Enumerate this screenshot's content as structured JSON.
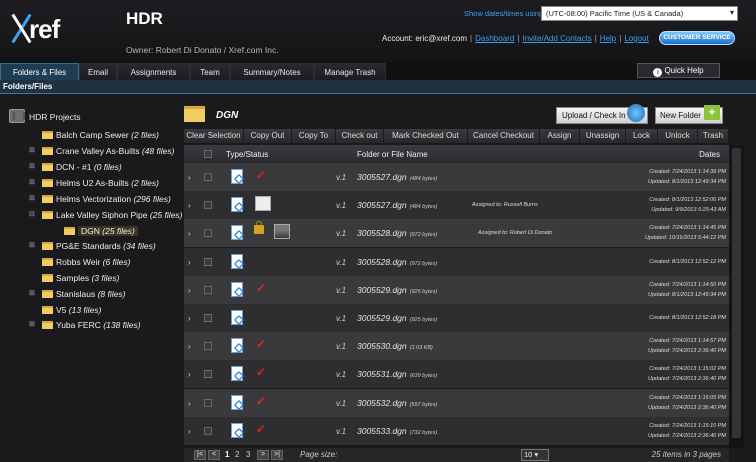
{
  "header": {
    "logo": "ref",
    "project_title": "HDR",
    "owner": "Owner: Robert Di Donato / Xref.com Inc.",
    "tz_label": "Show dates/times using:",
    "tz_value": "(UTC-08:00) Pacific Time (US & Canada)",
    "account": "Account: eric@xref.com",
    "links": [
      "Dashboard",
      "Invite/Add Contacts",
      "Help",
      "Logout"
    ],
    "customer_service": "CUSTOMER SERVICE"
  },
  "tabs": [
    "Folders & Files",
    "Email",
    "Assignments",
    "Team",
    "Summary/Notes",
    "Manage Trash"
  ],
  "quick_help": "Quick Help",
  "section_label": "Folders/Files",
  "tree": {
    "root": "HDR Projects",
    "items": [
      {
        "name": "Balch Camp Sewer",
        "count": "(2 files)"
      },
      {
        "name": "Crane Valley As-Builts",
        "count": "(48 files)"
      },
      {
        "name": "DCN - #1",
        "count": "(0 files)"
      },
      {
        "name": "Helms U2 As-Builts",
        "count": "(2 files)"
      },
      {
        "name": "Helms Vectorization",
        "count": "(296 files)"
      },
      {
        "name": "Lake Valley Siphon Pipe",
        "count": "(25 files)"
      },
      {
        "name": "DGN",
        "count": "(25 files)"
      },
      {
        "name": "PG&E Standards",
        "count": "(34 files)"
      },
      {
        "name": "Robbs Weir",
        "count": "(6 files)"
      },
      {
        "name": "Samples",
        "count": "(3 files)"
      },
      {
        "name": "Stanislaus",
        "count": "(8 files)"
      },
      {
        "name": "V5",
        "count": "(13 files)"
      },
      {
        "name": "Yuba FERC",
        "count": "(138 files)"
      }
    ]
  },
  "current_folder": "DGN",
  "buttons": {
    "upload": "Upload / Check In",
    "new_folder": "New Folder"
  },
  "actions": [
    "Clear Selection",
    "Copy Out",
    "Copy To",
    "Check out",
    "Mark Checked Out",
    "Cancel Checkout",
    "Assign",
    "Unassign",
    "Lock",
    "Unlock",
    "Trash"
  ],
  "columns": {
    "type": "Type/Status",
    "name": "Folder or File Name",
    "dates": "Dates"
  },
  "files": [
    {
      "ver": "v.1",
      "name": "3005527.dgn",
      "size": "(484 bytes)",
      "assigned": "",
      "created": "Created: 7/24/2013 1:14:39 PM",
      "updated": "Updated: 8/1/2013 12:49:34 PM",
      "check": true,
      "lock": false,
      "avatar": "none"
    },
    {
      "ver": "v.1",
      "name": "3005527.dgn",
      "size": "(484 bytes)",
      "assigned": "Assigned to: Russell Burns",
      "created": "Created: 8/1/2013 12:52:06 PM",
      "updated": "Updated: 9/9/2013 6:25:43 AM",
      "check": false,
      "lock": false,
      "avatar": "blank"
    },
    {
      "ver": "v.1",
      "name": "3005528.dgn",
      "size": "(972 bytes)",
      "assigned": "Assigned to: Robert Di Donato",
      "created": "Created: 7/24/2013 1:14:45 PM",
      "updated": "Updated: 10/16/2013 5:44:12 PM",
      "check": false,
      "lock": true,
      "avatar": "photo"
    },
    {
      "ver": "v.1",
      "name": "3005528.dgn",
      "size": "(972 bytes)",
      "assigned": "",
      "created": "Created: 8/1/2013 12:52:12 PM",
      "updated": "",
      "check": false,
      "lock": false,
      "avatar": "none"
    },
    {
      "ver": "v.1",
      "name": "3005529.dgn",
      "size": "(925 bytes)",
      "assigned": "",
      "created": "Created: 7/24/2013 1:14:50 PM",
      "updated": "Updated: 8/1/2013 12:49:34 PM",
      "check": true,
      "lock": false,
      "avatar": "none"
    },
    {
      "ver": "v.1",
      "name": "3005529.dgn",
      "size": "(925 bytes)",
      "assigned": "",
      "created": "Created: 8/1/2013 12:52:18 PM",
      "updated": "",
      "check": false,
      "lock": false,
      "avatar": "none"
    },
    {
      "ver": "v.1",
      "name": "3005530.dgn",
      "size": "(1.03 KB)",
      "assigned": "",
      "created": "Created: 7/24/2013 1:14:57 PM",
      "updated": "Updated: 7/24/2013 2:36:40 PM",
      "check": true,
      "lock": false,
      "avatar": "none"
    },
    {
      "ver": "v.1",
      "name": "3005531.dgn",
      "size": "(639 bytes)",
      "assigned": "",
      "created": "Created: 7/24/2013 1:15:02 PM",
      "updated": "Updated: 7/24/2013 2:36:40 PM",
      "check": true,
      "lock": false,
      "avatar": "none"
    },
    {
      "ver": "v.1",
      "name": "3005532.dgn",
      "size": "(597 bytes)",
      "assigned": "",
      "created": "Created: 7/24/2013 1:15:05 PM",
      "updated": "Updated: 7/24/2013 2:36:40 PM",
      "check": true,
      "lock": false,
      "avatar": "none"
    },
    {
      "ver": "v.1",
      "name": "3005533.dgn",
      "size": "(732 bytes)",
      "assigned": "",
      "created": "Created: 7/24/2013 1:15:10 PM",
      "updated": "Updated: 7/24/2013 2:36:40 PM",
      "check": true,
      "lock": false,
      "avatar": "none"
    }
  ],
  "pager": {
    "pages": [
      "1",
      "2",
      "3"
    ],
    "page_size_label": "Page size:",
    "page_size": "10",
    "summary": "25 items in 3 pages"
  },
  "icons": [
    "folder-icon",
    "checkmark-icon",
    "lock-icon",
    "file-icon",
    "globe-icon",
    "plus-icon",
    "help-icon"
  ]
}
